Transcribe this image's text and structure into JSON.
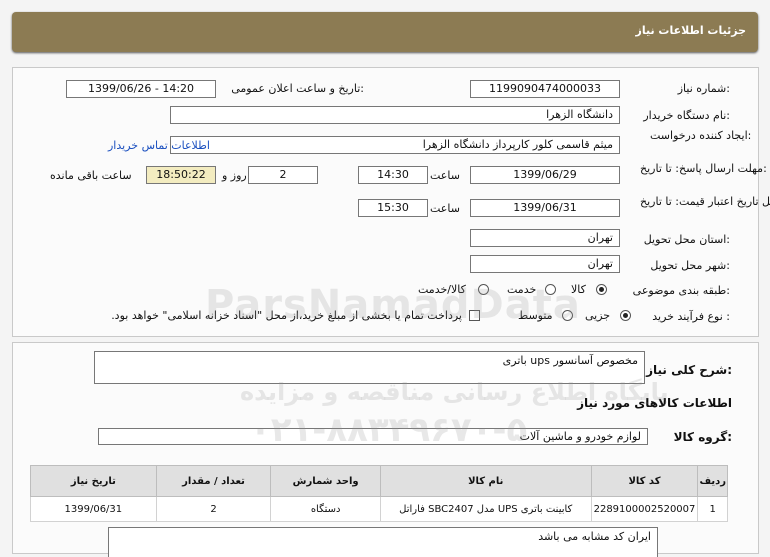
{
  "header": {
    "title": "جزئیات اطلاعات نیاز"
  },
  "form": {
    "need_number_label": "شماره نیاز:",
    "need_number": "1199090474000033",
    "announce_label": "تاریخ و ساعت اعلان عمومی:",
    "announce_value": "1399/06/26 - 14:20",
    "buyer_label": "نام دستگاه خریدار:",
    "buyer_value": "دانشگاه الزهرا",
    "creator_label": "ایجاد کننده درخواست:",
    "creator_value": "میثم  قاسمی کلور کارپرداز دانشگاه الزهرا",
    "contact_link": "اطلاعات تماس خریدار",
    "reply_label": "مهلت ارسال پاسخ: تا تاریخ:",
    "reply_date": "1399/06/29",
    "time_label": "ساعت",
    "reply_time": "14:30",
    "days_value": "2",
    "days_label": "روز و",
    "remaining_time": "18:50:22",
    "remaining_label": "ساعت باقی مانده",
    "validity_label": "حداقل تاریخ اعتبار قیمت: تا تاریخ:",
    "validity_date": "1399/06/31",
    "validity_time": "15:30",
    "province_label": "استان محل تحویل:",
    "province_value": "تهران",
    "city_label": "شهر محل تحویل:",
    "city_value": "تهران",
    "category_label": "طبقه بندی موضوعی:",
    "category_options": [
      "کالا",
      "خدمت",
      "کالا/خدمت"
    ],
    "category_selected": "کالا",
    "process_label": "نوع فرآیند خرید :",
    "process_options": [
      "جزیی",
      "متوسط"
    ],
    "process_selected": "جزیی",
    "payment_text": "پرداخت تمام یا بخشی از مبلغ خرید،از محل \"اسناد خزانه اسلامی\" خواهد بود."
  },
  "description": {
    "label": "شرح کلی نیاز:",
    "value": "باتری ups  مخصوص آسانسور"
  },
  "goods": {
    "section_title": "اطلاعات کالاهای مورد نیاز",
    "group_label": "گروه کالا:",
    "group_value": "لوازم خودرو و ماشین آلات",
    "columns": [
      "ردیف",
      "کد کالا",
      "نام کالا",
      "واحد شمارش",
      "تعداد / مقدار",
      "تاریخ نیاز"
    ],
    "rows": [
      [
        "1",
        "2289100002520007",
        "کابینت باتری UPS مدل SBC2407 فاراتل",
        "دستگاه",
        "2",
        "1399/06/31"
      ]
    ],
    "note": "ایران کد مشابه می باشد"
  },
  "watermark": {
    "brand": "ParsNamadData",
    "line1": "پایگاه اطلاع رسانی مناقصه و مزایده",
    "line2": "۰۲۱-۸۸۳۴۹۶۷۰-۵"
  }
}
